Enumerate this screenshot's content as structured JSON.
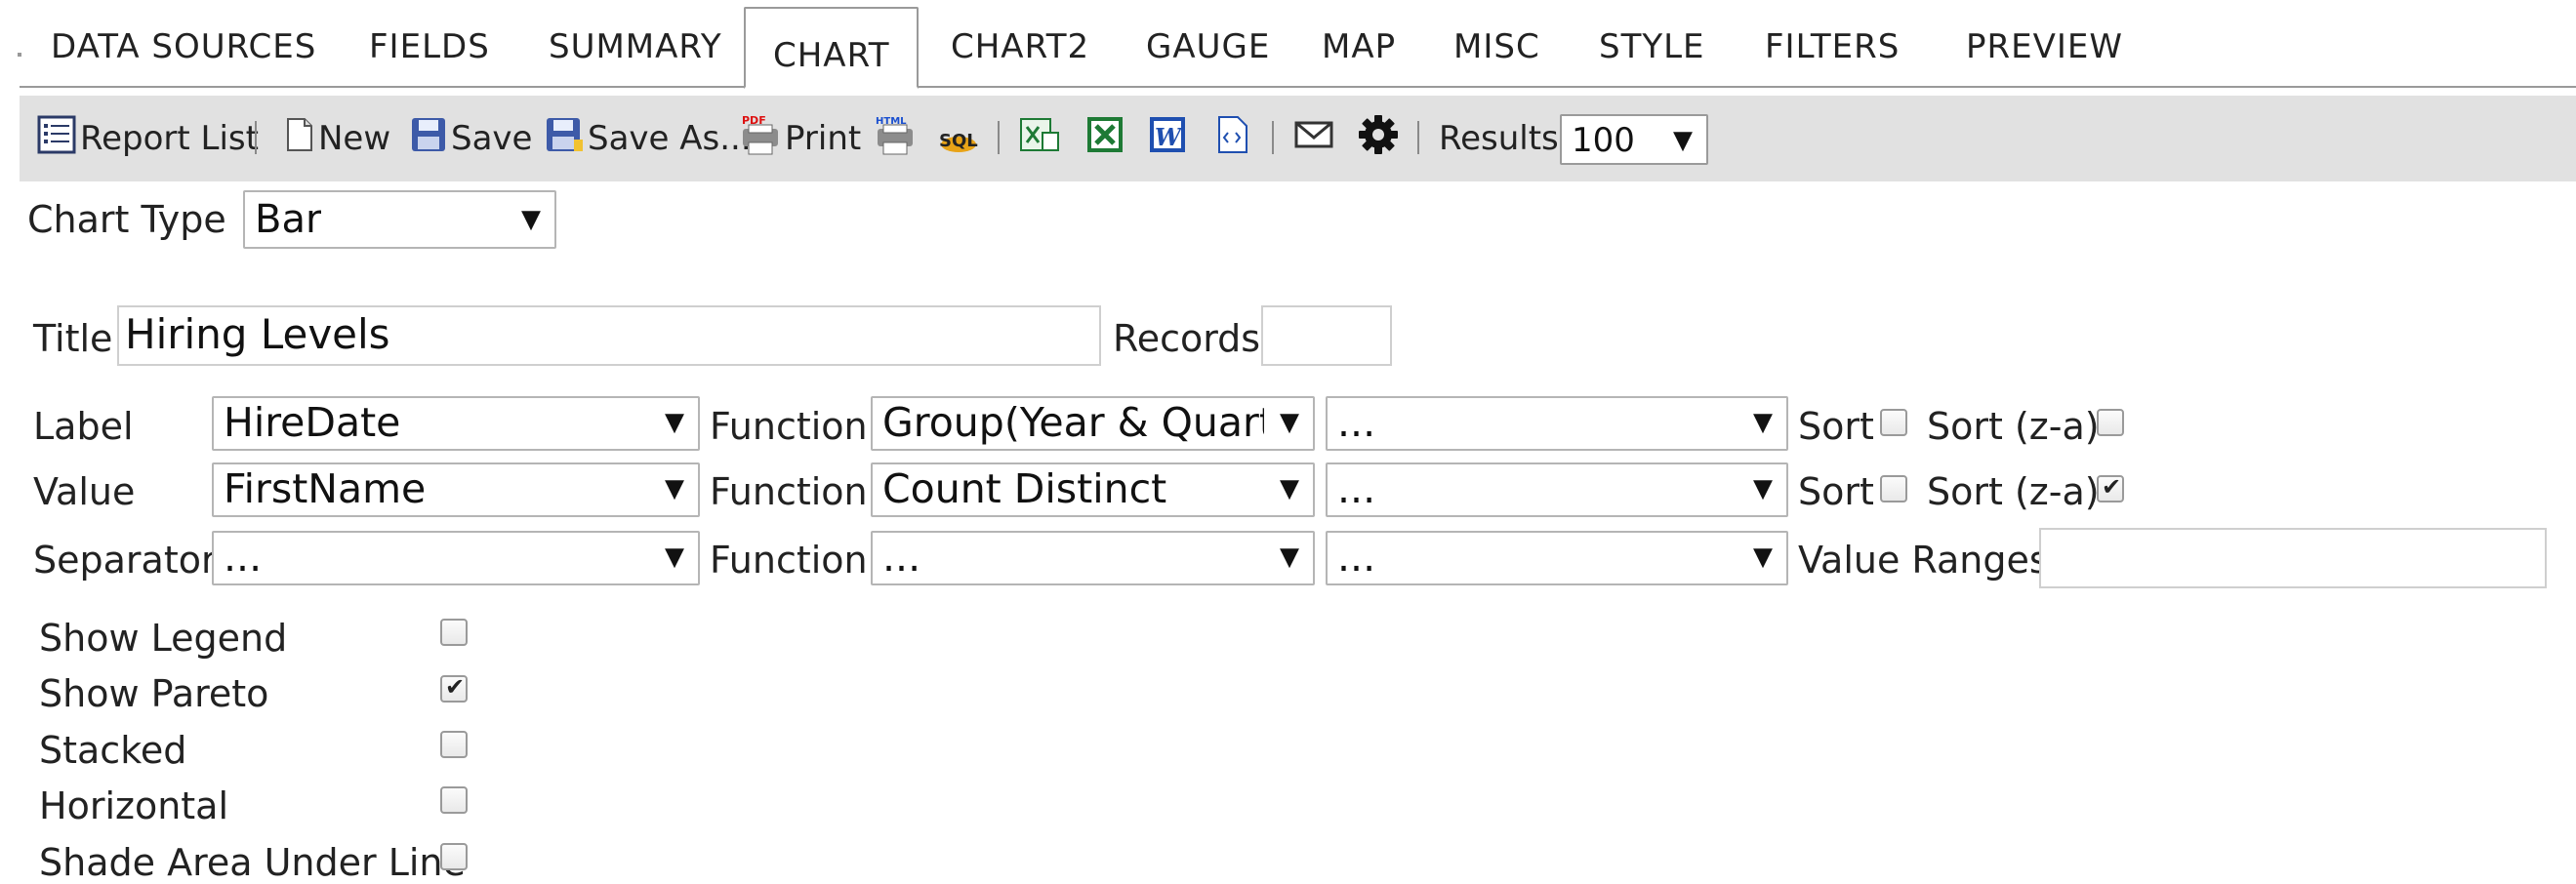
{
  "tabs": [
    {
      "label": "DATA SOURCES"
    },
    {
      "label": "FIELDS"
    },
    {
      "label": "SUMMARY"
    },
    {
      "label": "CHART"
    },
    {
      "label": "CHART2"
    },
    {
      "label": "GAUGE"
    },
    {
      "label": "MAP"
    },
    {
      "label": "MISC"
    },
    {
      "label": "STYLE"
    },
    {
      "label": "FILTERS"
    },
    {
      "label": "PREVIEW"
    }
  ],
  "active_tab": "CHART",
  "toolbar": {
    "report_list": "Report List",
    "new": "New",
    "save": "Save",
    "save_as": "Save As...",
    "print": "Print",
    "results_label": "Results",
    "results_value": "100"
  },
  "chart_type": {
    "label": "Chart Type",
    "value": "Bar"
  },
  "title": {
    "label": "Title",
    "value": "Hiring Levels"
  },
  "records": {
    "label": "Records",
    "value": ""
  },
  "rows": {
    "label": {
      "label": "Label",
      "field": "HireDate",
      "function_label": "Function",
      "function": "Group(Year & Quarter)",
      "extra": "...",
      "sort_label": "Sort",
      "sort_checked": false,
      "sort_za_label": "Sort (z-a)",
      "sort_za_checked": false
    },
    "value": {
      "label": "Value",
      "field": "FirstName",
      "function_label": "Function",
      "function": "Count Distinct",
      "extra": "...",
      "sort_label": "Sort",
      "sort_checked": false,
      "sort_za_label": "Sort (z-a)",
      "sort_za_checked": true
    },
    "separator": {
      "label": "Separator",
      "field": "...",
      "function_label": "Function",
      "function": "...",
      "extra": "...",
      "value_ranges_label": "Value Ranges",
      "value_ranges": ""
    }
  },
  "options": [
    {
      "label": "Show Legend",
      "checked": false
    },
    {
      "label": "Show Pareto",
      "checked": true
    },
    {
      "label": "Stacked",
      "checked": false
    },
    {
      "label": "Horizontal",
      "checked": false
    },
    {
      "label": "Shade Area Under Line",
      "checked": false
    }
  ]
}
